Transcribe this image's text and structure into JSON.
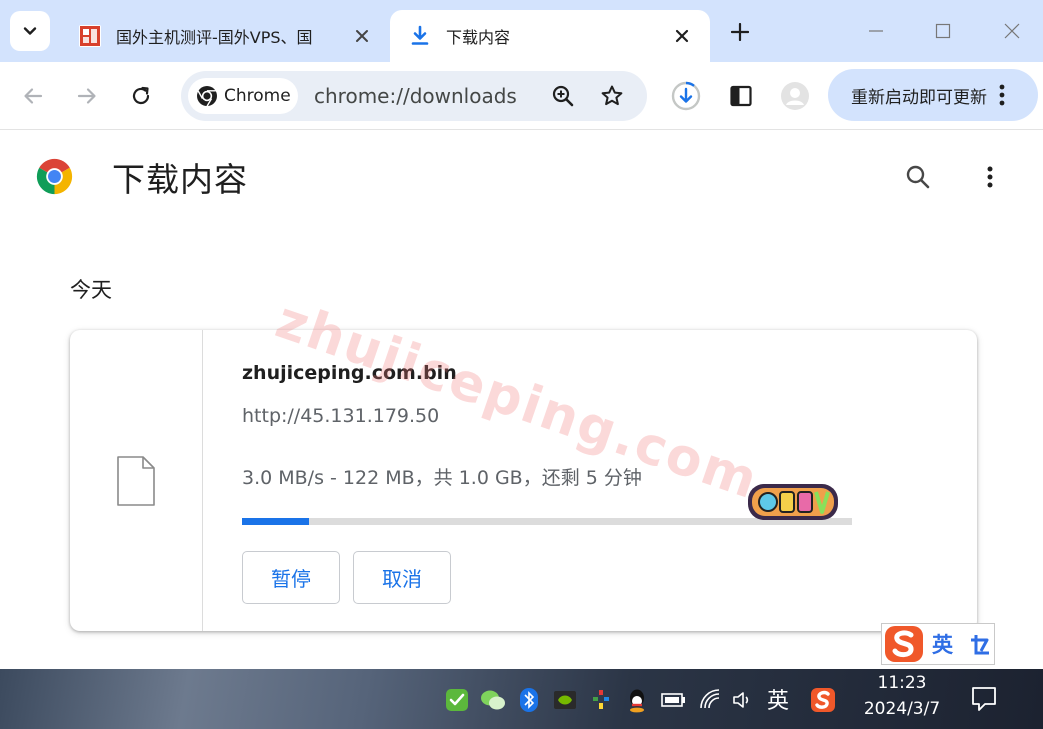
{
  "tabs": [
    {
      "title": "国外主机测评-国外VPS、国",
      "active": false
    },
    {
      "title": "下载内容",
      "active": true
    }
  ],
  "toolbar": {
    "chip_label": "Chrome",
    "url": "chrome://downloads",
    "update_label": "重新启动即可更新"
  },
  "page": {
    "title": "下载内容",
    "section": "今天"
  },
  "download": {
    "filename": "zhujiceping.com.bin",
    "source": "http://45.131.179.50",
    "status": "3.0 MB/s - 122 MB，共 1.0 GB，还剩 5 分钟",
    "progress_fraction": 0.11,
    "pause_label": "暂停",
    "cancel_label": "取消"
  },
  "watermark": "zhujiceping.com",
  "ime": {
    "mode": "英"
  },
  "taskbar": {
    "lang": "英",
    "time": "11:23",
    "date": "2024/3/7"
  },
  "colors": {
    "accent": "#1a73e8",
    "tabstrip": "#d3e3fd",
    "omnibox": "#e9eef6"
  }
}
